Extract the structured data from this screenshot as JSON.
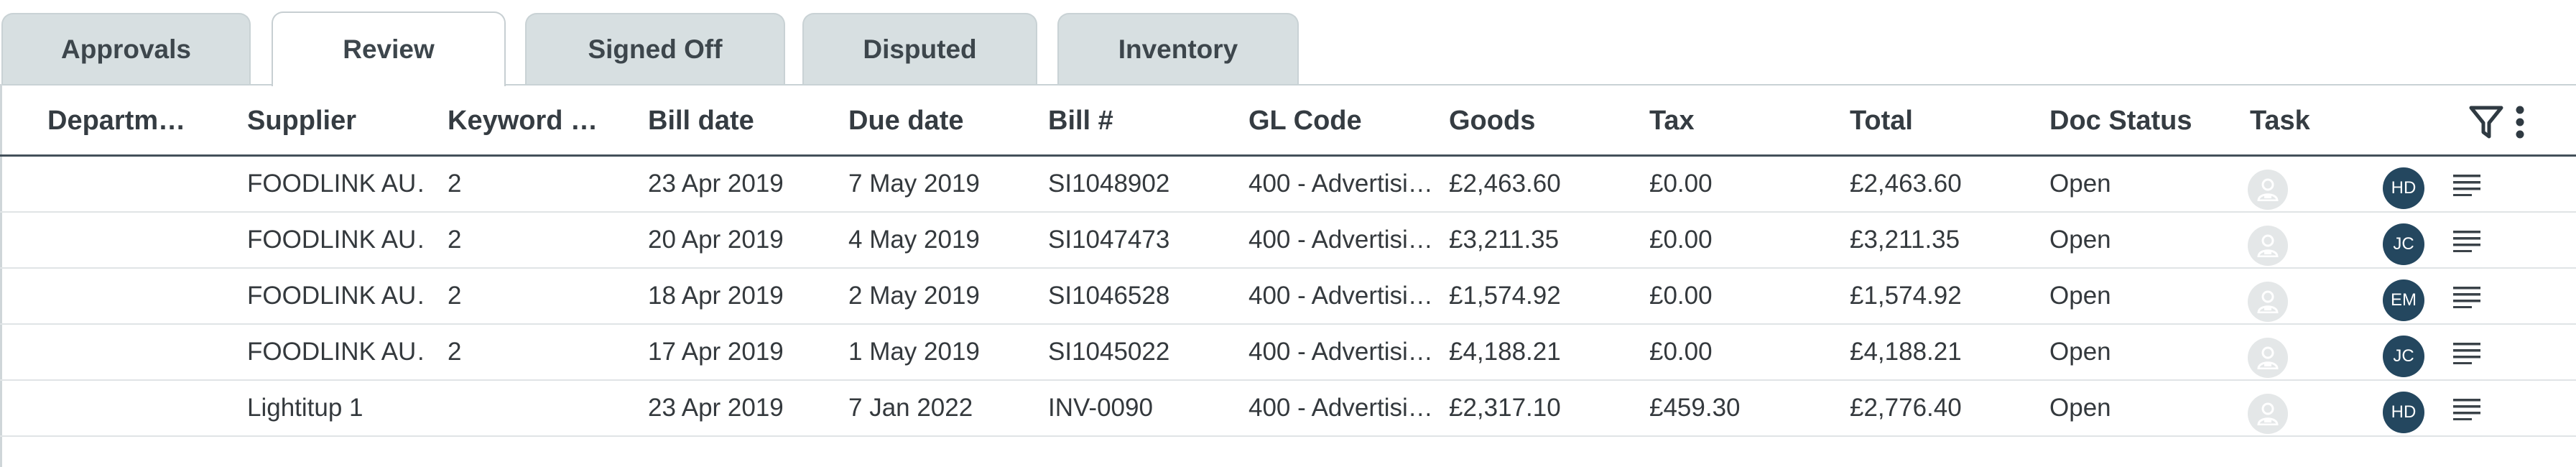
{
  "tabs": [
    {
      "label": "Approvals",
      "active": false
    },
    {
      "label": "Review",
      "active": true
    },
    {
      "label": "Signed Off",
      "active": false
    },
    {
      "label": "Disputed",
      "active": false
    },
    {
      "label": "Inventory",
      "active": false
    }
  ],
  "columns": [
    "Departm…",
    "Supplier",
    "Keyword …",
    "Bill date",
    "Due date",
    "Bill #",
    "GL Code",
    "Goods",
    "Tax",
    "Total",
    "Doc Status",
    "Task"
  ],
  "header_icons": {
    "filter": "filter-icon",
    "menu": "kebab-menu-icon"
  },
  "rows": [
    {
      "department": "",
      "supplier": "FOODLINK AU…",
      "keyword": "2",
      "bill_date": "23 Apr 2019",
      "due_date": "7 May 2019",
      "bill_no": "SI1048902",
      "gl_code": "400 - Advertisi…",
      "goods": "£2,463.60",
      "tax": "£0.00",
      "total": "£2,463.60",
      "doc_status": "Open",
      "assignee": "HD"
    },
    {
      "department": "",
      "supplier": "FOODLINK AU…",
      "keyword": "2",
      "bill_date": "20 Apr 2019",
      "due_date": "4 May 2019",
      "bill_no": "SI1047473",
      "gl_code": "400 - Advertisi…",
      "goods": "£3,211.35",
      "tax": "£0.00",
      "total": "£3,211.35",
      "doc_status": "Open",
      "assignee": "JC"
    },
    {
      "department": "",
      "supplier": "FOODLINK AU…",
      "keyword": "2",
      "bill_date": "18 Apr 2019",
      "due_date": "2 May 2019",
      "bill_no": "SI1046528",
      "gl_code": "400 - Advertisi…",
      "goods": "£1,574.92",
      "tax": "£0.00",
      "total": "£1,574.92",
      "doc_status": "Open",
      "assignee": "EM"
    },
    {
      "department": "",
      "supplier": "FOODLINK AU…",
      "keyword": "2",
      "bill_date": "17 Apr 2019",
      "due_date": "1 May 2019",
      "bill_no": "SI1045022",
      "gl_code": "400 - Advertisi…",
      "goods": "£4,188.21",
      "tax": "£0.00",
      "total": "£4,188.21",
      "doc_status": "Open",
      "assignee": "JC"
    },
    {
      "department": "",
      "supplier": "Lightitup 1",
      "keyword": "",
      "bill_date": "23 Apr 2019",
      "due_date": "7 Jan 2022",
      "bill_no": "INV-0090",
      "gl_code": "400 - Advertisi…",
      "goods": "£2,317.10",
      "tax": "£459.30",
      "total": "£2,776.40",
      "doc_status": "Open",
      "assignee": "HD"
    }
  ],
  "colors": {
    "avatar": "#24475f",
    "tab_bg": "#d7dfe1",
    "header_rule": "#43505a"
  }
}
